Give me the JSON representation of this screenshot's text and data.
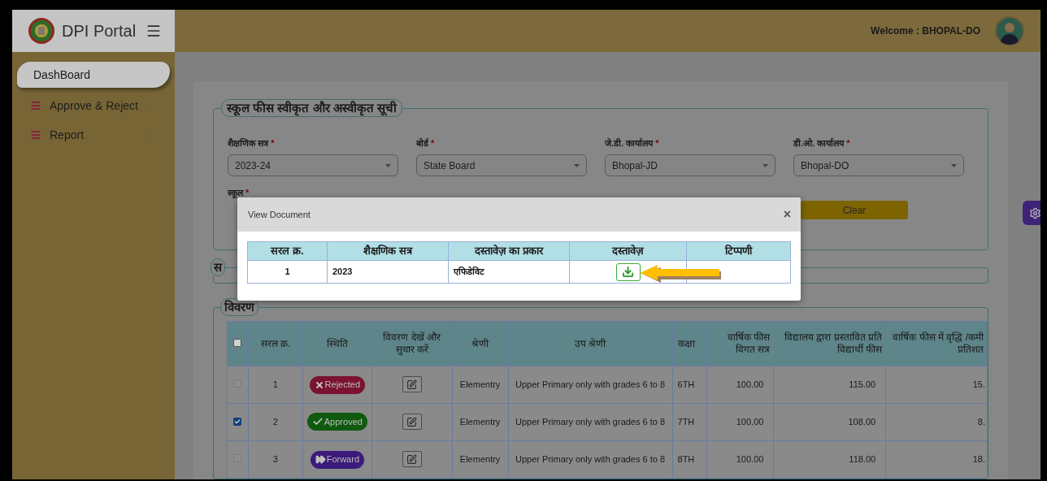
{
  "sidebar": {
    "brand": "DPI Portal",
    "items": [
      {
        "label": "DashBoard",
        "selected": true,
        "kind": "link"
      },
      {
        "label": "Approve & Reject",
        "selected": false,
        "kind": "menu"
      },
      {
        "label": "Report",
        "selected": false,
        "kind": "menu"
      }
    ]
  },
  "header": {
    "welcome": "Welcome : BHOPAL-DO"
  },
  "filter_panel": {
    "title": "स्कूल फीस स्वीकृत और अस्वीकृत सूची",
    "fields": [
      {
        "label": "शैक्षणिक सत्र",
        "required_mark": "*",
        "value": "2023-24"
      },
      {
        "label": "बोर्ड",
        "required_mark": "*",
        "value": "State Board"
      },
      {
        "label": "जे.डी. कार्यालय",
        "required_mark": "*",
        "value": "Bhopal-JD"
      },
      {
        "label": "डी.ओ. कार्यालय",
        "required_mark": "*",
        "value": "Bhopal-DO"
      }
    ],
    "school": {
      "label": "स्कूल",
      "required_mark": "*"
    },
    "clear_button": "Clear"
  },
  "second_panel": {
    "title": "स"
  },
  "details": {
    "title": "विवरण",
    "all_checked": false,
    "columns": [
      "सरल क्र.",
      "स्थिति",
      "विवरण देखें और सुधार करें",
      "श्रेणी",
      "उप श्रेणी",
      "कक्षा",
      "वार्षिक फीस विगत सत्र",
      "विद्यालय द्वारा प्रस्तावित प्रति विद्यार्थी फीस",
      "वार्षिक फीस में वृद्धि /कमी प्रतिशत"
    ],
    "rows": [
      {
        "checked": false,
        "disabled": true,
        "serial": "1",
        "status": {
          "kind": "rejected",
          "label": "Rejected"
        },
        "category": "Elementry",
        "subcategory": "Upper Primary only with grades 6 to 8",
        "class": "6TH",
        "prev_fee": "100.00",
        "proposed_fee": "115.00",
        "change": "15."
      },
      {
        "checked": true,
        "disabled": false,
        "serial": "2",
        "status": {
          "kind": "approved",
          "label": "Approved"
        },
        "category": "Elementry",
        "subcategory": "Upper Primary only with grades 6 to 8",
        "class": "7TH",
        "prev_fee": "100.00",
        "proposed_fee": "108.00",
        "change": "8."
      },
      {
        "checked": false,
        "disabled": true,
        "serial": "3",
        "status": {
          "kind": "forward",
          "label": "Forward"
        },
        "category": "Elementry",
        "subcategory": "Upper Primary only with grades 6 to 8",
        "class": "8TH",
        "prev_fee": "100.00",
        "proposed_fee": "118.00",
        "change": "18."
      }
    ]
  },
  "modal": {
    "title": "View Document",
    "close": "×",
    "columns": [
      "सरल क्र.",
      "शैक्षणिक सत्र",
      "दस्तावेज़ का प्रकार",
      "दस्तावेज़",
      "टिप्पणी"
    ],
    "rows": [
      {
        "serial": "1",
        "session": "2023",
        "doc_type": "एफिडेविट"
      }
    ]
  }
}
